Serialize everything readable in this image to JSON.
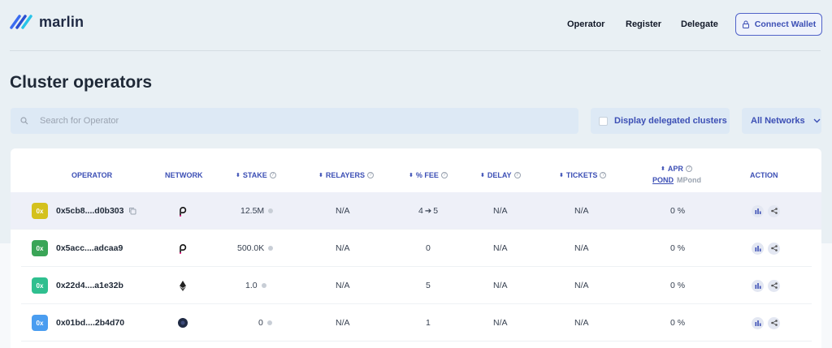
{
  "app": {
    "brand": "marlin"
  },
  "nav": {
    "operator": "Operator",
    "register": "Register",
    "delegate": "Delegate",
    "connect_wallet": "Connect Wallet"
  },
  "page": {
    "title": "Cluster operators"
  },
  "filters": {
    "search_placeholder": "Search for Operator",
    "delegated_label": "Display delegated clusters",
    "network_select": "All Networks"
  },
  "table": {
    "headers": {
      "operator": "OPERATOR",
      "network": "NETWORK",
      "stake": "STAKE",
      "relayers": "RELAYERS",
      "fee": "% FEE",
      "delay": "DELAY",
      "tickets": "TICKETS",
      "apr": "APR",
      "apr_pond": "POND",
      "apr_mpond": "MPond",
      "action": "ACTION"
    },
    "rows": [
      {
        "badge": "0x",
        "badge_color": "#d4c11d",
        "address": "0x5cb8....d0b303",
        "network": "polkadot-icon",
        "stake": "12.5M",
        "relayers": "N/A",
        "fee_from": "4",
        "fee_to": "5",
        "delay": "N/A",
        "tickets": "N/A",
        "apr": "0 %"
      },
      {
        "badge": "0x",
        "badge_color": "#3aa557",
        "address": "0x5acc....adcaa9",
        "network": "polkadot-icon",
        "stake": "500.0K",
        "relayers": "N/A",
        "fee": "0",
        "delay": "N/A",
        "tickets": "N/A",
        "apr": "0 %"
      },
      {
        "badge": "0x",
        "badge_color": "#2fbf8f",
        "address": "0x22d4....a1e32b",
        "network": "ethereum-icon",
        "stake": "1.0",
        "relayers": "N/A",
        "fee": "5",
        "delay": "N/A",
        "tickets": "N/A",
        "apr": "0 %"
      },
      {
        "badge": "0x",
        "badge_color": "#4a9df0",
        "address": "0x01bd....2b4d70",
        "network": "near-icon",
        "stake": "0",
        "relayers": "N/A",
        "fee": "1",
        "delay": "N/A",
        "tickets": "N/A",
        "apr": "0 %"
      }
    ]
  },
  "colors": {
    "accent": "#3c4fb5",
    "header_bg": "#e9f0f4"
  }
}
